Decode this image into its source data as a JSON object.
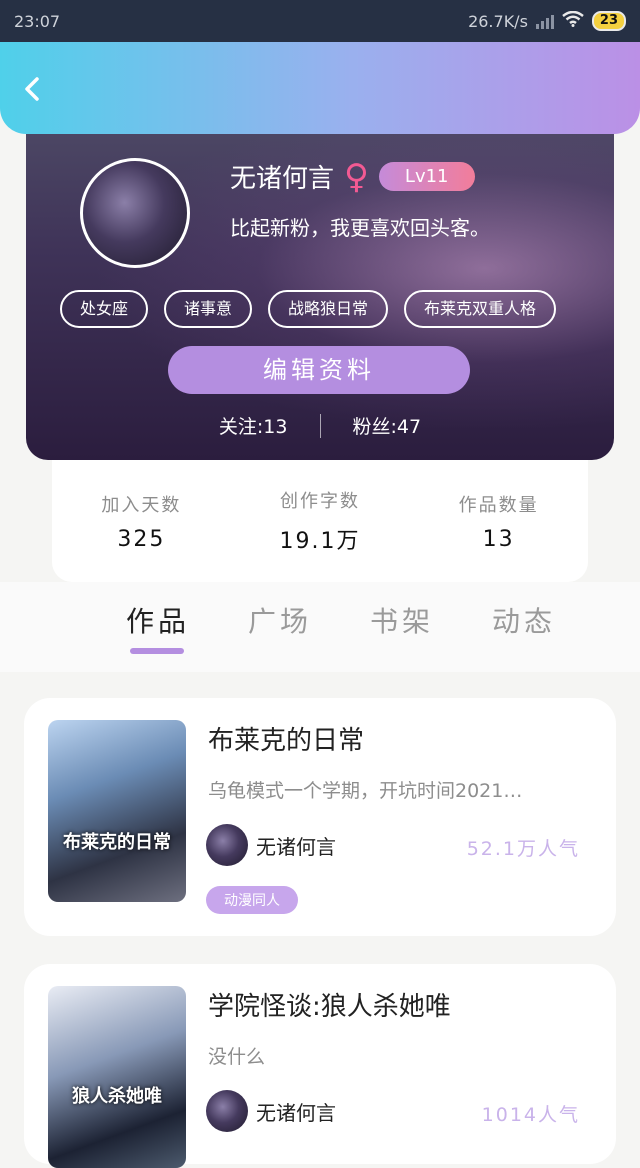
{
  "status_bar": {
    "time": "23:07",
    "network_speed": "26.7K/s",
    "battery": "23"
  },
  "profile": {
    "name": "无诸何言",
    "gender_symbol": "♀",
    "level": "Lv11",
    "bio": "比起新粉，我更喜欢回头客。",
    "tags": [
      "处女座",
      "诸事意",
      "战略狼日常",
      "布莱克双重人格"
    ],
    "edit_button": "编辑资料",
    "following": "关注:13",
    "followers": "粉丝:47"
  },
  "stats": [
    {
      "label": "加入天数",
      "value": "325"
    },
    {
      "label": "创作字数",
      "value": "19.1万"
    },
    {
      "label": "作品数量",
      "value": "13"
    }
  ],
  "tabs": [
    "作品",
    "广场",
    "书架",
    "动态"
  ],
  "works": [
    {
      "title": "布莱克的日常",
      "cover_text": "布莱克的日常",
      "description": "乌龟模式一个学期，开坑时间2021…",
      "author": "无诸何言",
      "popularity": "52.1万人气",
      "category": "动漫同人"
    },
    {
      "title": "学院怪谈:狼人杀她唯",
      "cover_text": "狼人杀她唯",
      "description": "没什么",
      "author": "无诸何言",
      "popularity": "1014人气"
    }
  ]
}
